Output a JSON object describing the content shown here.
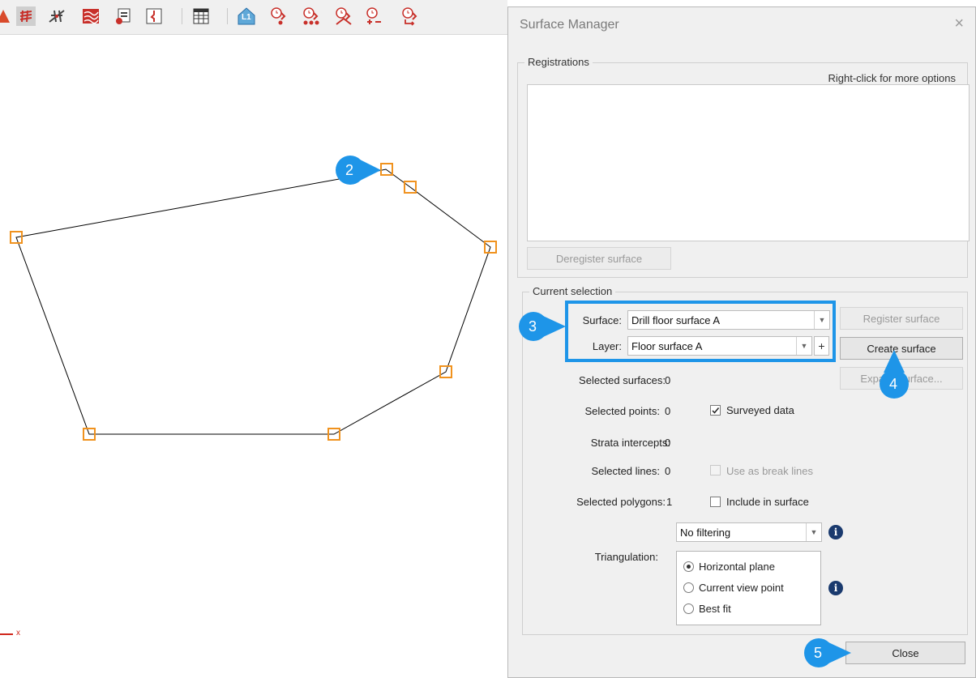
{
  "toolbar": {
    "icons": [
      "surface-icon",
      "surface-active-icon",
      "road-icon",
      "strata-icon",
      "report-icon",
      "profile-icon",
      "table-icon",
      "level-icon",
      "survey-point-icon",
      "survey-points-icon",
      "survey-triangle-icon",
      "survey-add-remove-icon",
      "survey-swap-icon"
    ],
    "level_label": "L1"
  },
  "canvas": {
    "axis_label": "x",
    "polygon_color": "#000000",
    "vertex_color": "#f0921e"
  },
  "dialog": {
    "title": "Surface Manager",
    "close_symbol": "×",
    "registrations": {
      "group_title": "Registrations",
      "hint": "Right-click for more options",
      "deregister_label": "Deregister surface"
    },
    "current_selection": {
      "group_title": "Current selection",
      "surface_label": "Surface:",
      "surface_value": "Drill floor surface A",
      "layer_label": "Layer:",
      "layer_value": "Floor surface A",
      "plus_symbol": "+",
      "register_label": "Register surface",
      "create_label": "Create surface",
      "expand_label": "Expand surface...",
      "selected_surfaces_label": "Selected surfaces:",
      "selected_surfaces_value": "0",
      "selected_points_label": "Selected points:",
      "selected_points_value": "0",
      "surveyed_data_label": "Surveyed data",
      "surveyed_data_checked": true,
      "strata_intercepts_label": "Strata intercepts:",
      "strata_intercepts_value": "0",
      "selected_lines_label": "Selected lines:",
      "selected_lines_value": "0",
      "use_break_lines_label": "Use as break lines",
      "selected_polygons_label": "Selected polygons:",
      "selected_polygons_value": "1",
      "include_surface_label": "Include in surface",
      "filter_value": "No filtering",
      "triangulation_label": "Triangulation:",
      "radio_options": [
        "Horizontal plane",
        "Current view point",
        "Best fit"
      ],
      "radio_selected": "Horizontal plane",
      "info_symbol": "i"
    },
    "close_label": "Close"
  },
  "callouts": {
    "two": "2",
    "three": "3",
    "four": "4",
    "five": "5",
    "color": "#1e95e8",
    "highlight_color": "#1e95e8"
  }
}
